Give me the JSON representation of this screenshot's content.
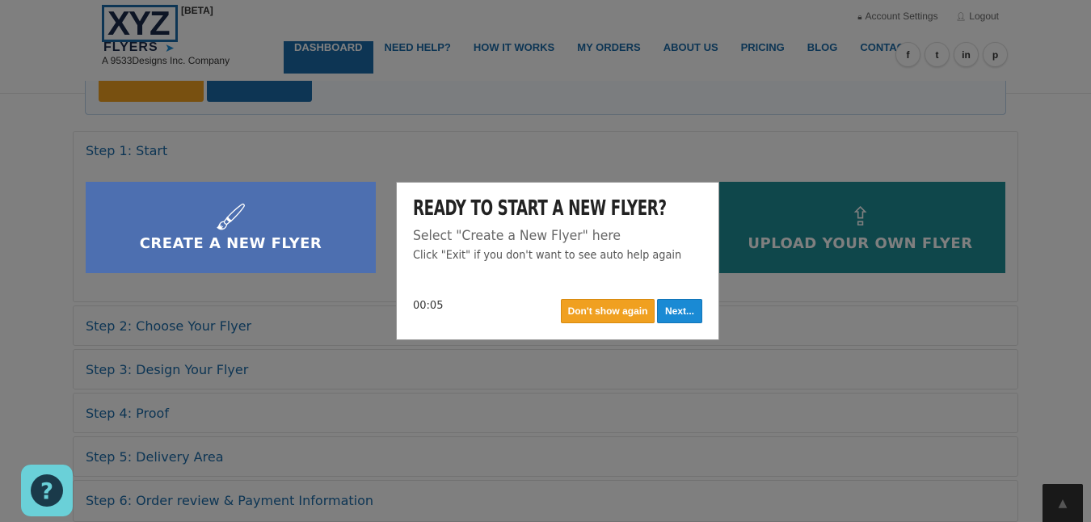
{
  "logo": {
    "mark": "XYZ",
    "wordmark": "FLYERS",
    "badge": "[BETA]",
    "tagline": "A 9533Designs Inc. Company"
  },
  "top_links": {
    "account": "Account Settings",
    "logout": "Logout"
  },
  "nav": [
    {
      "label": "DASHBOARD",
      "active": true
    },
    {
      "label": "NEED HELP?"
    },
    {
      "label": "HOW IT WORKS"
    },
    {
      "label": "MY ORDERS"
    },
    {
      "label": "ABOUT US"
    },
    {
      "label": "PRICING"
    },
    {
      "label": "BLOG"
    },
    {
      "label": "CONTACT"
    }
  ],
  "social": {
    "facebook": "f",
    "twitter": "t",
    "linkedin": "in",
    "pinterest": "p"
  },
  "steps": {
    "step1": "Step 1: Start",
    "step2": "Step 2: Choose Your Flyer",
    "step3": "Step 3: Design Your Flyer",
    "step4": "Step 4: Proof",
    "step5": "Step 5: Delivery Area",
    "step6": "Step 6: Order review & Payment Information"
  },
  "tiles": {
    "create": "CREATE A NEW FLYER",
    "upload": "UPLOAD YOUR OWN FLYER"
  },
  "popup": {
    "title": "READY TO START A NEW FLYER?",
    "subtitle": "Select \"Create a New Flyer\" here",
    "hint": "Click \"Exit\" if you don't want to see auto help again",
    "timer": "00:05",
    "dont_show": "Don't show again",
    "next": "Next..."
  },
  "colors": {
    "brand": "#1a6aa8",
    "orange": "#f0a020",
    "create_tile": "#5b8ce8",
    "upload_tile": "#1f8e96",
    "help": "#6ad0d8"
  }
}
